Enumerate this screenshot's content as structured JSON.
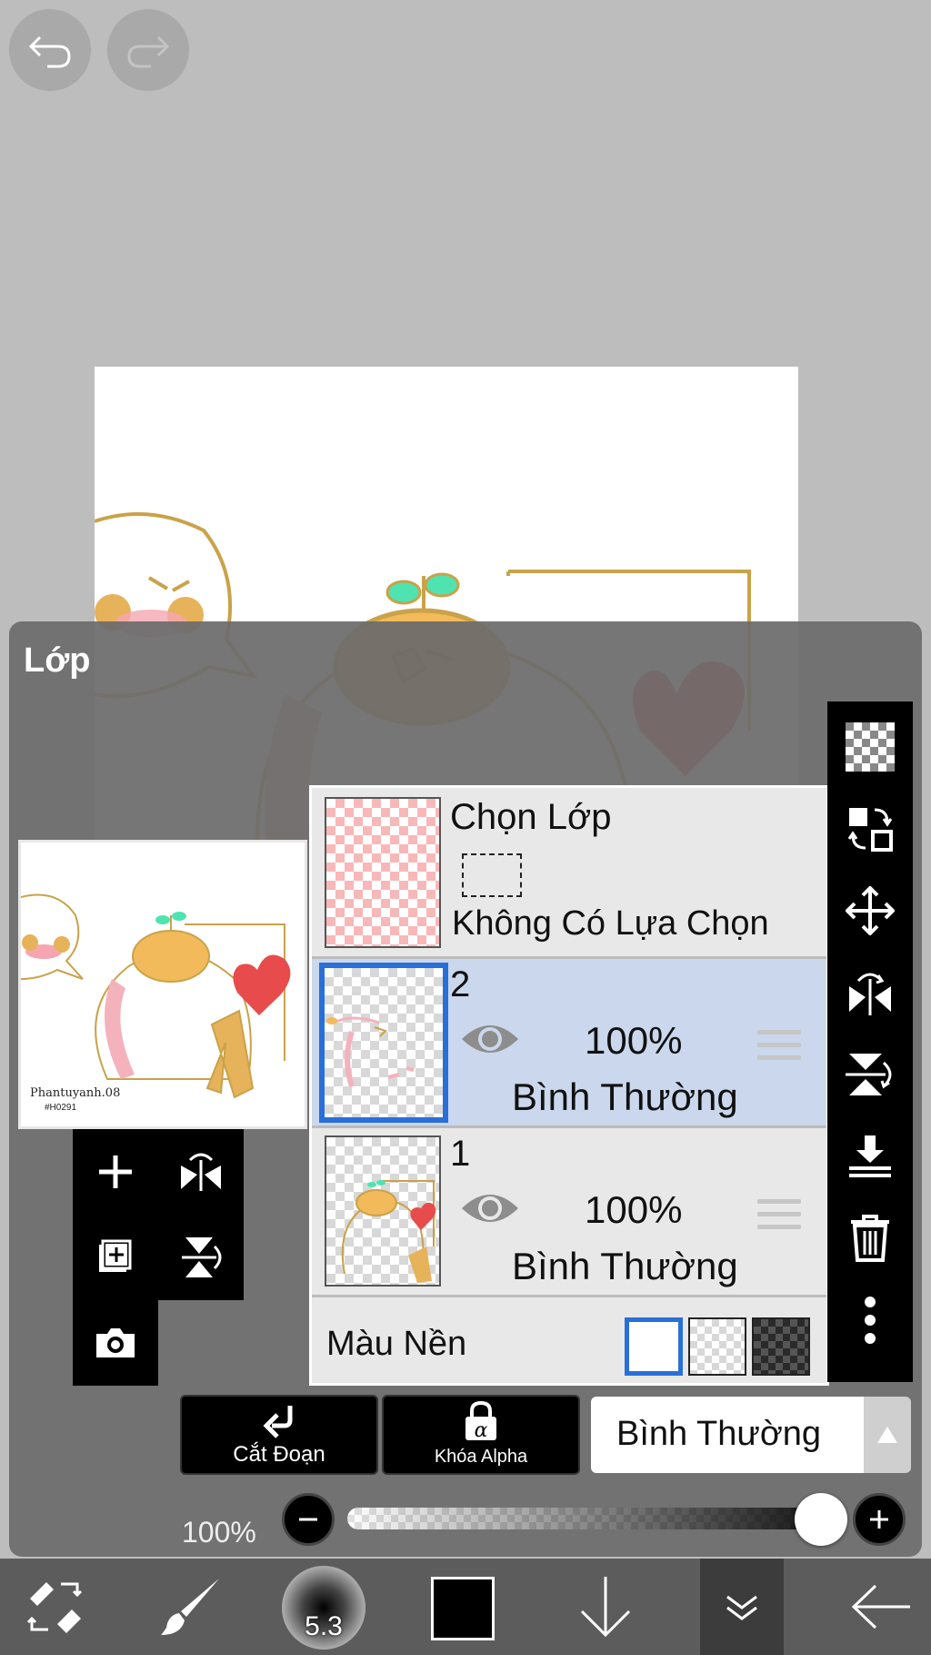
{
  "top_controls": {
    "undo": "undo-icon",
    "redo": "redo-icon"
  },
  "canvas": {
    "signature": "Phantuyanh.08",
    "signature_sub": "#H0291"
  },
  "panel": {
    "title": "Lớp",
    "selection_layer": {
      "title": "Chọn Lớp",
      "status": "Không Có Lựa Chọn"
    },
    "layers": [
      {
        "name": "2",
        "opacity": "100%",
        "blend": "Bình Thường",
        "selected": true
      },
      {
        "name": "1",
        "opacity": "100%",
        "blend": "Bình Thường",
        "selected": false
      }
    ],
    "background": {
      "label": "Màu Nền"
    },
    "clip_button": "Cắt Đoạn",
    "alpha_lock_button": "Khóa Alpha",
    "blend_mode": "Bình Thường",
    "opacity_label": "100%",
    "opacity_value": 1.0
  },
  "bottom_bar": {
    "brush_size": "5.3",
    "color": "#000000"
  },
  "colors": {
    "accent": "#2a6fd8",
    "selected_row": "#cad7ec"
  }
}
